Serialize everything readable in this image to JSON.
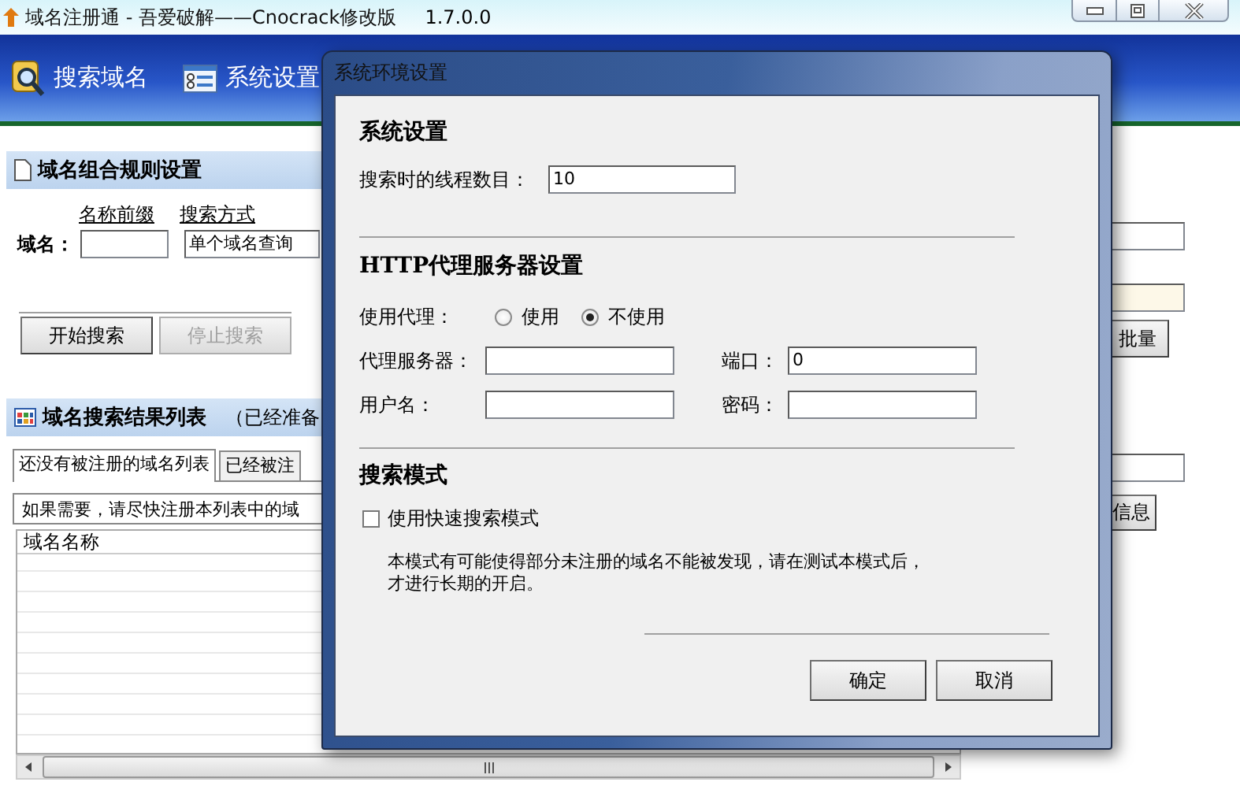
{
  "window": {
    "title": "域名注册通 - 吾爱破解——Cnocrack修改版",
    "version": "1.7.0.0"
  },
  "toolbar": [
    {
      "label": "搜索域名"
    },
    {
      "label": "系统设置"
    }
  ],
  "rules_panel": {
    "title": "域名组合规则设置",
    "prefix_label": "名称前缀",
    "mode_label": "搜索方式",
    "domain_label": "域名：",
    "mode_value": "单个域名查询",
    "buttons": [
      {
        "label": "开始搜索",
        "disabled": false
      },
      {
        "label": "停止搜索",
        "disabled": true
      }
    ]
  },
  "results_panel": {
    "title": "域名搜索结果列表",
    "note": "（已经准备",
    "tabs": [
      {
        "label": "还没有被注册的域名列表",
        "selected": true
      },
      {
        "label": "已经被注",
        "selected": false
      }
    ],
    "info": "如果需要，请尽快注册本列表中的域",
    "columns": [
      "域名名称"
    ]
  },
  "right_panel": {
    "buttons": [
      "批量",
      "信息"
    ]
  },
  "dialog": {
    "title": "系统环境设置",
    "system": {
      "heading": "系统设置",
      "threads_label": "搜索时的线程数目：",
      "threads_value": "10"
    },
    "proxy": {
      "heading": "HTTP代理服务器设置",
      "use_label": "使用代理：",
      "options": [
        {
          "label": "使用",
          "selected": false
        },
        {
          "label": "不使用",
          "selected": true
        }
      ],
      "server_label": "代理服务器：",
      "port_label": "端口：",
      "port_value": "0",
      "user_label": "用户名：",
      "password_label": "密码："
    },
    "search_mode": {
      "heading": "搜索模式",
      "fast_label": "使用快速搜索模式",
      "checked": false,
      "note_lines": [
        "本模式有可能使得部分未注册的域名不能被发现，请在测试本模式后，",
        "才进行长期的开启。"
      ]
    },
    "buttons": [
      "确定",
      "取消"
    ]
  }
}
